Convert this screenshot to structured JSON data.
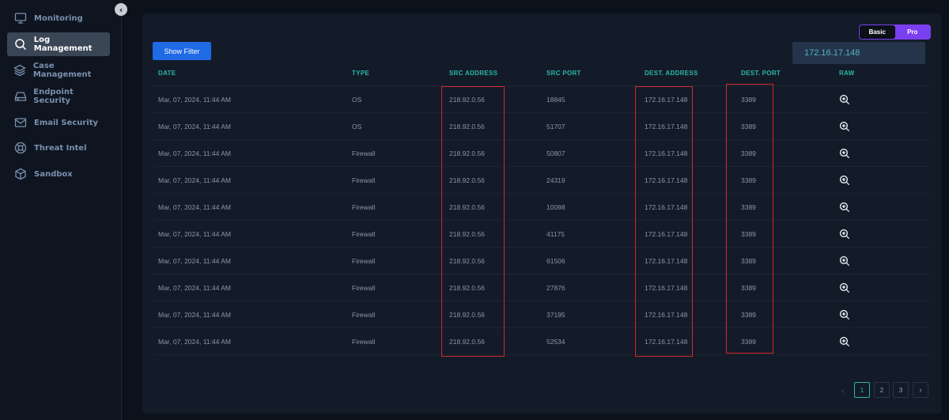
{
  "sidebar": {
    "collapse_icon": "chevron-left-icon",
    "items": [
      {
        "label": "Monitoring",
        "icon": "monitor-icon",
        "active": false
      },
      {
        "label": "Log Management",
        "icon": "search-icon",
        "active": true
      },
      {
        "label": "Case Management",
        "icon": "layers-icon",
        "active": false
      },
      {
        "label": "Endpoint Security",
        "icon": "hard-drive-icon",
        "active": false
      },
      {
        "label": "Email Security",
        "icon": "mail-icon",
        "active": false
      },
      {
        "label": "Threat Intel",
        "icon": "lifebuoy-icon",
        "active": false
      },
      {
        "label": "Sandbox",
        "icon": "box-icon",
        "active": false
      }
    ]
  },
  "toolbar": {
    "show_filter_label": "Show Filter",
    "mode_toggle": {
      "options": [
        "Basic",
        "Pro"
      ],
      "selected": "Basic"
    },
    "search_value": "172.16.17.148"
  },
  "table": {
    "columns": [
      "DATE",
      "TYPE",
      "SRC ADDRESS",
      "SRC PORT",
      "DEST. ADDRESS",
      "DEST. PORT",
      "RAW"
    ],
    "rows": [
      {
        "date": "Mar, 07, 2024, 11:44 AM",
        "type": "OS",
        "src": "218.92.0.56",
        "sport": "18845",
        "dest": "172.16.17.148",
        "dport": "3389"
      },
      {
        "date": "Mar, 07, 2024, 11:44 AM",
        "type": "OS",
        "src": "218.92.0.56",
        "sport": "51707",
        "dest": "172.16.17.148",
        "dport": "3389"
      },
      {
        "date": "Mar, 07, 2024, 11:44 AM",
        "type": "Firewall",
        "src": "218.92.0.56",
        "sport": "50807",
        "dest": "172.16.17.148",
        "dport": "3389"
      },
      {
        "date": "Mar, 07, 2024, 11:44 AM",
        "type": "Firewall",
        "src": "218.92.0.56",
        "sport": "24319",
        "dest": "172.16.17.148",
        "dport": "3389"
      },
      {
        "date": "Mar, 07, 2024, 11:44 AM",
        "type": "Firewall",
        "src": "218.92.0.56",
        "sport": "10098",
        "dest": "172.16.17.148",
        "dport": "3389"
      },
      {
        "date": "Mar, 07, 2024, 11:44 AM",
        "type": "Firewall",
        "src": "218.92.0.56",
        "sport": "41175",
        "dest": "172.16.17.148",
        "dport": "3389"
      },
      {
        "date": "Mar, 07, 2024, 11:44 AM",
        "type": "Firewall",
        "src": "218.92.0.56",
        "sport": "61506",
        "dest": "172.16.17.148",
        "dport": "3389"
      },
      {
        "date": "Mar, 07, 2024, 11:44 AM",
        "type": "Firewall",
        "src": "218.92.0.56",
        "sport": "27876",
        "dest": "172.16.17.148",
        "dport": "3389"
      },
      {
        "date": "Mar, 07, 2024, 11:44 AM",
        "type": "Firewall",
        "src": "218.92.0.56",
        "sport": "37195",
        "dest": "172.16.17.148",
        "dport": "3389"
      },
      {
        "date": "Mar, 07, 2024, 11:44 AM",
        "type": "Firewall",
        "src": "218.92.0.56",
        "sport": "52534",
        "dest": "172.16.17.148",
        "dport": "3389"
      }
    ],
    "raw_icon": "zoom-in-icon"
  },
  "pagination": {
    "pages": [
      "1",
      "2",
      "3"
    ],
    "current": "1",
    "prev_label": "‹",
    "next_label": "›"
  },
  "colors": {
    "accent_teal": "#2cb6a8",
    "primary_button": "#1f6ae5",
    "toggle_purple": "#7b3ff2",
    "highlight_red": "#d3282a"
  }
}
